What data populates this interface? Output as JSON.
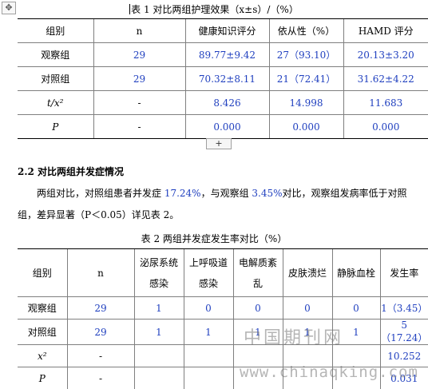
{
  "table1": {
    "title": "表 1 对比两组护理效果（x±s）/（%）",
    "headers": [
      "组别",
      "n",
      "健康知识评分",
      "依从性（%）",
      "HAMD 评分"
    ],
    "rows": [
      [
        "观察组",
        "29",
        "89.77±9.42",
        "27（93.10）",
        "20.13±3.20"
      ],
      [
        "对照组",
        "29",
        "70.32±8.11",
        "21（72.41）",
        "31.62±4.22"
      ],
      [
        "t/x²",
        "-",
        "8.426",
        "14.998",
        "11.683"
      ],
      [
        "P",
        "-",
        "0.000",
        "0.000",
        "0.000"
      ]
    ],
    "expand_label": "+"
  },
  "move_handle": "✥",
  "section": {
    "heading": "2.2 对比两组并发症情况",
    "para_line1": "两组对比，对照组患者并发症 17.24%，与观察组 3.45%对比，观察组发病率低于对照",
    "para_line2": "组，差异显著（P＜0.05）详见表 2。"
  },
  "table2": {
    "title": "表 2 两组并发症发生率对比（%）",
    "headers": [
      "组别",
      "n",
      "泌尿系统\n感染",
      "上呼吸道\n感染",
      "电解质紊\n乱",
      "皮肤溃烂",
      "静脉血栓",
      "发生率"
    ],
    "rows": [
      [
        "观察组",
        "29",
        "1",
        "0",
        "0",
        "0",
        "0",
        "1（3.45）"
      ],
      [
        "对照组",
        "29",
        "1",
        "1",
        "1",
        "1",
        "1",
        "5（17.24）"
      ],
      [
        "x²",
        "-",
        "",
        "",
        "",
        "",
        "",
        "10.252"
      ],
      [
        "P",
        "-",
        "",
        "",
        "",
        "",
        "",
        "0.031"
      ]
    ]
  },
  "watermark": {
    "cn": "中国期刊网",
    "url": "www.chinaqking.com"
  },
  "colors": {
    "value_text": "#1f3fbf",
    "border": "#7f7f7f"
  }
}
